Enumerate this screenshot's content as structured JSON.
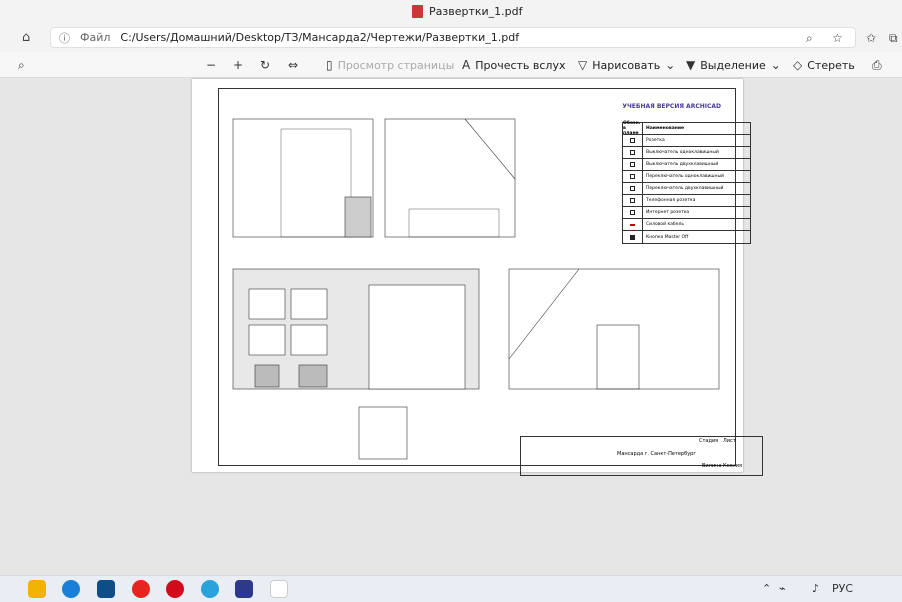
{
  "window": {
    "tab_title": "Развертки_1.pdf"
  },
  "address": {
    "info_label": "Файл",
    "url": "C:/Users/Домашний/Desktop/ТЗ/Мансарда2/Чертежи/Развертки_1.pdf"
  },
  "toolbar": {
    "page_view": "Просмотр страницы",
    "read_aloud": "Прочесть вслух",
    "draw": "Нарисовать",
    "highlight": "Выделение",
    "erase": "Стереть"
  },
  "document": {
    "watermark": "УЧЕБНАЯ ВЕРСИЯ ARCHICAD",
    "legend": {
      "col1": "Обозн. в плане",
      "col2": "Наименование",
      "items": [
        "Розетка",
        "Выключатель одноклавишный",
        "Выключатель двухклавишный",
        "Переключатель одноклавишный",
        "Переключатель двухклавишный",
        "Телефонная розетка",
        "Интернет розетка",
        "Силовой кабель",
        "Кнопка Master Off"
      ]
    },
    "stamp": {
      "city": "Мансарда г. Санкт-Петербург",
      "stage": "Стадия",
      "sheet": "Лист",
      "author": "Вилина Ксения"
    }
  },
  "tray": {
    "lang": "РУС"
  }
}
